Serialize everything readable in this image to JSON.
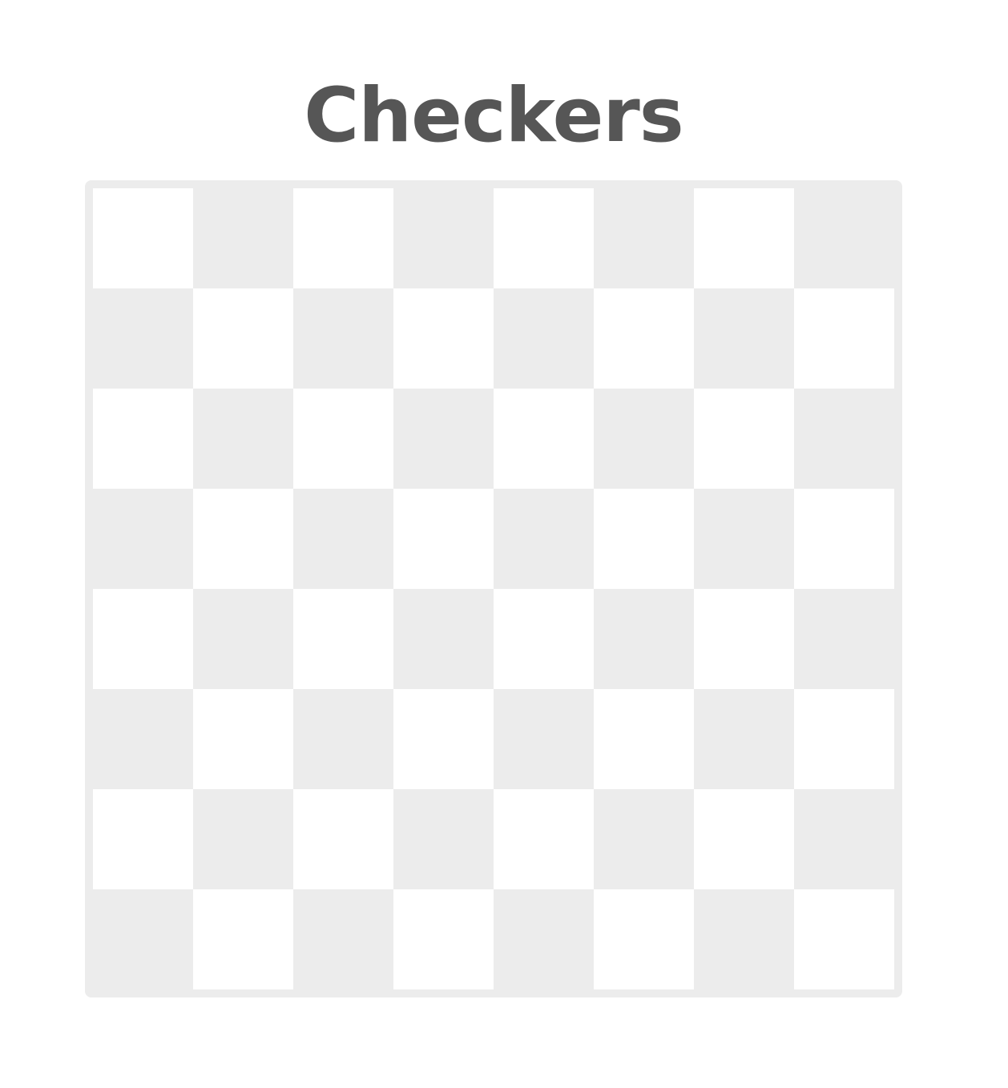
{
  "title": "Checkers",
  "colors": {
    "title_text": "#565656",
    "board_frame": "#ececec",
    "light_square": "#ffffff",
    "dark_square": "#ececec"
  },
  "board": {
    "rows": 8,
    "cols": 8,
    "first_square": "light",
    "pieces": []
  }
}
